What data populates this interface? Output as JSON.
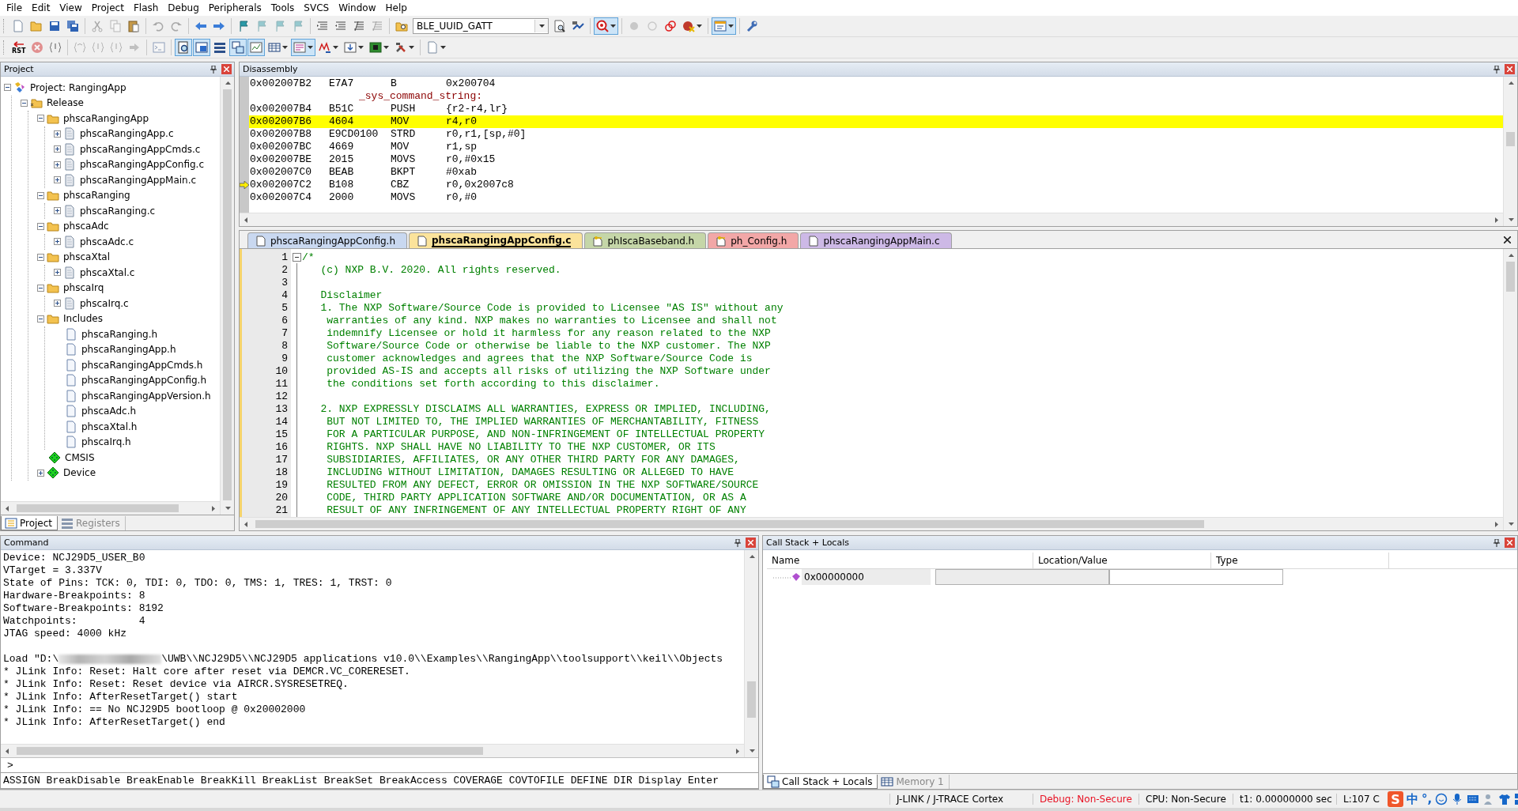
{
  "menu": [
    "File",
    "Edit",
    "View",
    "Project",
    "Flash",
    "Debug",
    "Peripherals",
    "Tools",
    "SVCS",
    "Window",
    "Help"
  ],
  "toolbar_1": [
    {
      "kind": "button",
      "on": false,
      "disabled": false
    },
    {
      "kind": "button",
      "on": false,
      "disabled": false
    },
    {
      "kind": "button",
      "on": false,
      "disabled": false
    },
    {
      "kind": "button",
      "on": false,
      "disabled": false
    },
    {
      "kind": "separator"
    },
    {
      "kind": "button",
      "on": false,
      "disabled": true
    },
    {
      "kind": "button",
      "on": false,
      "disabled": true
    },
    {
      "kind": "button",
      "on": false,
      "disabled": false
    },
    {
      "kind": "separator"
    },
    {
      "kind": "button",
      "on": false,
      "disabled": true
    },
    {
      "kind": "button",
      "on": false,
      "disabled": true
    },
    {
      "kind": "separator"
    },
    {
      "kind": "button",
      "on": false,
      "disabled": false
    },
    {
      "kind": "button",
      "on": false,
      "disabled": false
    },
    {
      "kind": "separator"
    },
    {
      "kind": "button",
      "on": false,
      "disabled": false
    },
    {
      "kind": "button",
      "on": false,
      "disabled": true
    },
    {
      "kind": "button",
      "on": false,
      "disabled": true
    },
    {
      "kind": "button",
      "on": false,
      "disabled": true
    },
    {
      "kind": "separator"
    },
    {
      "kind": "button",
      "on": false,
      "disabled": false
    },
    {
      "kind": "button",
      "on": false,
      "disabled": false
    },
    {
      "kind": "button",
      "on": false,
      "disabled": false
    },
    {
      "kind": "button",
      "on": false,
      "disabled": true
    },
    {
      "kind": "separator"
    },
    {
      "kind": "button",
      "on": false,
      "disabled": false
    },
    {
      "kind": "select",
      "value": "BLE_UUID_GATT"
    },
    {
      "kind": "button",
      "on": false,
      "disabled": false
    },
    {
      "kind": "button",
      "on": false,
      "disabled": false
    },
    {
      "kind": "separator"
    },
    {
      "kind": "menu-button",
      "on": true,
      "disabled": false
    },
    {
      "kind": "separator"
    },
    {
      "kind": "button",
      "on": false,
      "disabled": true
    },
    {
      "kind": "button",
      "on": false,
      "disabled": true
    },
    {
      "kind": "button",
      "on": false,
      "disabled": false
    },
    {
      "kind": "menu-button",
      "on": false,
      "disabled": false
    },
    {
      "kind": "separator"
    },
    {
      "kind": "menu-button",
      "on": true,
      "disabled": false
    },
    {
      "kind": "separator"
    },
    {
      "kind": "button",
      "on": false,
      "disabled": false
    }
  ],
  "toolbar_2": [
    {
      "kind": "reset",
      "label": "RST",
      "on": false,
      "disabled": false
    },
    {
      "kind": "button",
      "on": false,
      "disabled": true
    },
    {
      "kind": "button",
      "on": false,
      "disabled": false
    },
    {
      "kind": "separator"
    },
    {
      "kind": "button",
      "on": false,
      "disabled": true
    },
    {
      "kind": "button",
      "on": false,
      "disabled": true
    },
    {
      "kind": "button",
      "on": false,
      "disabled": true
    },
    {
      "kind": "button",
      "on": false,
      "disabled": true
    },
    {
      "kind": "separator"
    },
    {
      "kind": "button",
      "on": false,
      "disabled": true
    },
    {
      "kind": "separator"
    },
    {
      "kind": "button",
      "on": true,
      "disabled": false
    },
    {
      "kind": "button",
      "on": true,
      "disabled": false
    },
    {
      "kind": "button",
      "on": false,
      "disabled": false
    },
    {
      "kind": "button",
      "on": true,
      "disabled": false
    },
    {
      "kind": "button",
      "on": true,
      "disabled": false
    },
    {
      "kind": "menu-button",
      "on": false,
      "disabled": false
    },
    {
      "kind": "menu-button",
      "on": true,
      "disabled": false
    },
    {
      "kind": "menu-button",
      "on": false,
      "disabled": false
    },
    {
      "kind": "menu-button",
      "on": false,
      "disabled": false
    },
    {
      "kind": "menu-button",
      "on": false,
      "disabled": false
    },
    {
      "kind": "menu-button",
      "on": false,
      "disabled": false
    },
    {
      "kind": "separator"
    },
    {
      "kind": "menu-button",
      "on": false,
      "disabled": false
    }
  ],
  "project_panel": {
    "title": "Project",
    "tree": [
      {
        "label": "Project: RangingApp",
        "kind": "project",
        "expanded": true,
        "children": [
          {
            "label": "Release",
            "kind": "target",
            "expanded": true,
            "children": [
              {
                "label": "phscaRangingApp",
                "kind": "group",
                "expanded": true,
                "children": [
                  {
                    "label": "phscaRangingApp.c",
                    "kind": "source",
                    "expanded": false
                  },
                  {
                    "label": "phscaRangingAppCmds.c",
                    "kind": "source",
                    "expanded": false
                  },
                  {
                    "label": "phscaRangingAppConfig.c",
                    "kind": "source",
                    "expanded": false
                  },
                  {
                    "label": "phscaRangingAppMain.c",
                    "kind": "source",
                    "expanded": false
                  }
                ]
              },
              {
                "label": "phscaRanging",
                "kind": "group",
                "expanded": true,
                "children": [
                  {
                    "label": "phscaRanging.c",
                    "kind": "source",
                    "expanded": false
                  }
                ]
              },
              {
                "label": "phscaAdc",
                "kind": "group",
                "expanded": true,
                "children": [
                  {
                    "label": "phscaAdc.c",
                    "kind": "source",
                    "expanded": false
                  }
                ]
              },
              {
                "label": "phscaXtal",
                "kind": "group",
                "expanded": true,
                "children": [
                  {
                    "label": "phscaXtal.c",
                    "kind": "source",
                    "expanded": false
                  }
                ]
              },
              {
                "label": "phscaIrq",
                "kind": "group",
                "expanded": true,
                "children": [
                  {
                    "label": "phscaIrq.c",
                    "kind": "source",
                    "expanded": false
                  }
                ]
              },
              {
                "label": "Includes",
                "kind": "group",
                "expanded": true,
                "children": [
                  {
                    "label": "phscaRanging.h",
                    "kind": "header"
                  },
                  {
                    "label": "phscaRangingApp.h",
                    "kind": "header"
                  },
                  {
                    "label": "phscaRangingAppCmds.h",
                    "kind": "header"
                  },
                  {
                    "label": "phscaRangingAppConfig.h",
                    "kind": "header"
                  },
                  {
                    "label": "phscaRangingAppVersion.h",
                    "kind": "header"
                  },
                  {
                    "label": "phscaAdc.h",
                    "kind": "header"
                  },
                  {
                    "label": "phscaXtal.h",
                    "kind": "header"
                  },
                  {
                    "label": "phscaIrq.h",
                    "kind": "header"
                  }
                ]
              },
              {
                "label": "CMSIS",
                "kind": "component"
              },
              {
                "label": "Device",
                "kind": "component",
                "expanded": false
              }
            ]
          }
        ]
      }
    ],
    "tabs": [
      {
        "label": "Project",
        "selected": true
      },
      {
        "label": "Registers",
        "selected": false
      }
    ]
  },
  "disassembly": {
    "title": "Disassembly",
    "rows": [
      {
        "kind": "instruction",
        "address": "0x002007B2",
        "code": "E7A7",
        "mnemonic": "B",
        "operands": "0x200704",
        "current": false,
        "pointer": false
      },
      {
        "kind": "label",
        "text": "_sys_command_string:"
      },
      {
        "kind": "instruction",
        "address": "0x002007B4",
        "code": "B51C",
        "mnemonic": "PUSH",
        "operands": "{r2-r4,lr}",
        "current": false,
        "pointer": false
      },
      {
        "kind": "instruction",
        "address": "0x002007B6",
        "code": "4604",
        "mnemonic": "MOV",
        "operands": "r4,r0",
        "current": true,
        "pointer": false
      },
      {
        "kind": "instruction",
        "address": "0x002007B8",
        "code": "E9CD0100",
        "mnemonic": "STRD",
        "operands": "r0,r1,[sp,#0]",
        "current": false,
        "pointer": false
      },
      {
        "kind": "instruction",
        "address": "0x002007BC",
        "code": "4669",
        "mnemonic": "MOV",
        "operands": "r1,sp",
        "current": false,
        "pointer": false
      },
      {
        "kind": "instruction",
        "address": "0x002007BE",
        "code": "2015",
        "mnemonic": "MOVS",
        "operands": "r0,#0x15",
        "current": false,
        "pointer": false
      },
      {
        "kind": "instruction",
        "address": "0x002007C0",
        "code": "BEAB",
        "mnemonic": "BKPT",
        "operands": "#0xab",
        "current": false,
        "pointer": false
      },
      {
        "kind": "instruction",
        "address": "0x002007C2",
        "code": "B108",
        "mnemonic": "CBZ",
        "operands": "r0,0x2007c8",
        "current": false,
        "pointer": true
      },
      {
        "kind": "instruction",
        "address": "0x002007C4",
        "code": "2000",
        "mnemonic": "MOVS",
        "operands": "r0,#0",
        "current": false,
        "pointer": false
      }
    ]
  },
  "editor": {
    "tabs": [
      {
        "label": "phscaRangingAppConfig.h",
        "kind": "file",
        "selected": false,
        "color": "#c9d8f0"
      },
      {
        "label": "phscaRangingAppConfig.c",
        "kind": "file",
        "selected": true,
        "color": "#fbe39b"
      },
      {
        "label": "phIscaBaseband.h",
        "kind": "locked",
        "selected": false,
        "color": "#c5d6a8"
      },
      {
        "label": "ph_Config.h",
        "kind": "locked",
        "selected": false,
        "color": "#f2a7a7"
      },
      {
        "label": "phscaRangingAppMain.c",
        "kind": "file",
        "selected": false,
        "color": "#cdb9e6"
      }
    ],
    "lines": [
      {
        "number": "1",
        "text": "/*",
        "fold": true
      },
      {
        "number": "2",
        "text": "   (c) NXP B.V. 2020. All rights reserved.",
        "fold": false
      },
      {
        "number": "3",
        "fold": false
      },
      {
        "number": "4",
        "text": "   Disclaimer",
        "fold": false
      },
      {
        "number": "5",
        "text": "   1. The NXP Software/Source Code is provided to Licensee \"AS IS\" without any",
        "fold": false
      },
      {
        "number": "6",
        "text": "    warranties of any kind. NXP makes no warranties to Licensee and shall not",
        "fold": false
      },
      {
        "number": "7",
        "text": "    indemnify Licensee or hold it harmless for any reason related to the NXP",
        "fold": false
      },
      {
        "number": "8",
        "text": "    Software/Source Code or otherwise be liable to the NXP customer. The NXP",
        "fold": false
      },
      {
        "number": "9",
        "text": "    customer acknowledges and agrees that the NXP Software/Source Code is",
        "fold": false
      },
      {
        "number": "10",
        "text": "    provided AS-IS and accepts all risks of utilizing the NXP Software under",
        "fold": false
      },
      {
        "number": "11",
        "text": "    the conditions set forth according to this disclaimer.",
        "fold": false
      },
      {
        "number": "12",
        "fold": false
      },
      {
        "number": "13",
        "text": "   2. NXP EXPRESSLY DISCLAIMS ALL WARRANTIES, EXPRESS OR IMPLIED, INCLUDING,",
        "fold": false
      },
      {
        "number": "14",
        "text": "    BUT NOT LIMITED TO, THE IMPLIED WARRANTIES OF MERCHANTABILITY, FITNESS",
        "fold": false
      },
      {
        "number": "15",
        "text": "    FOR A PARTICULAR PURPOSE, AND NON-INFRINGEMENT OF INTELLECTUAL PROPERTY",
        "fold": false
      },
      {
        "number": "16",
        "text": "    RIGHTS. NXP SHALL HAVE NO LIABILITY TO THE NXP CUSTOMER, OR ITS",
        "fold": false
      },
      {
        "number": "17",
        "text": "    SUBSIDIARIES, AFFILIATES, OR ANY OTHER THIRD PARTY FOR ANY DAMAGES,",
        "fold": false
      },
      {
        "number": "18",
        "text": "    INCLUDING WITHOUT LIMITATION, DAMAGES RESULTING OR ALLEGED TO HAVE",
        "fold": false
      },
      {
        "number": "19",
        "text": "    RESULTED FROM ANY DEFECT, ERROR OR OMISSION IN THE NXP SOFTWARE/SOURCE",
        "fold": false
      },
      {
        "number": "20",
        "text": "    CODE, THIRD PARTY APPLICATION SOFTWARE AND/OR DOCUMENTATION, OR AS A",
        "fold": false
      },
      {
        "number": "21",
        "text": "    RESULT OF ANY INFRINGEMENT OF ANY INTELLECTUAL PROPERTY RIGHT OF ANY",
        "fold": false
      }
    ]
  },
  "command": {
    "title": "Command",
    "output": [
      {
        "kind": "text",
        "text": "Device: NCJ29D5_USER_B0"
      },
      {
        "kind": "text",
        "text": "VTarget = 3.337V"
      },
      {
        "kind": "text",
        "text": "State of Pins: TCK: 0, TDI: 0, TDO: 0, TMS: 1, TRES: 1, TRST: 0"
      },
      {
        "kind": "text",
        "text": "Hardware-Breakpoints: 8"
      },
      {
        "kind": "text",
        "text": "Software-Breakpoints: 8192"
      },
      {
        "kind": "text",
        "text": "Watchpoints:          4"
      },
      {
        "kind": "text",
        "text": "JTAG speed: 4000 kHz"
      },
      {
        "kind": "blank"
      },
      {
        "kind": "redacted",
        "before": "Load \"D:\\",
        "after": "\\UWB\\\\NCJ29D5\\\\NCJ29D5 applications v10.0\\\\Examples\\\\RangingApp\\\\toolsupport\\\\keil\\\\Objects"
      },
      {
        "kind": "text",
        "text": "* JLink Info: Reset: Halt core after reset via DEMCR.VC_CORERESET."
      },
      {
        "kind": "text",
        "text": "* JLink Info: Reset: Reset device via AIRCR.SYSRESETREQ."
      },
      {
        "kind": "text",
        "text": "* JLink Info: AfterResetTarget() start"
      },
      {
        "kind": "text",
        "text": "* JLink Info: == No NCJ29D5 bootloop @ 0x20002000"
      },
      {
        "kind": "text",
        "text": "* JLink Info: AfterResetTarget() end"
      }
    ],
    "prompt": ">",
    "commands": "ASSIGN BreakDisable BreakEnable BreakKill BreakList BreakSet BreakAccess COVERAGE COVTOFILE DEFINE DIR Display Enter"
  },
  "call_stack": {
    "title": "Call Stack + Locals",
    "columns": [
      "Name",
      "Location/Value",
      "Type"
    ],
    "rows": [
      {
        "name": "0x00000000"
      }
    ],
    "tabs": [
      {
        "label": "Call Stack + Locals",
        "selected": true
      },
      {
        "label": "Memory 1",
        "selected": false
      }
    ]
  },
  "status_bar": [
    {
      "text": "J-LINK / J-TRACE Cortex",
      "color": "#000000"
    },
    {
      "text": "Debug: Non-Secure",
      "color": "#e81123"
    },
    {
      "text": "CPU: Non-Secure",
      "color": "#000000"
    },
    {
      "text": "t1: 0.00000000 sec",
      "color": "#000000"
    },
    {
      "text": "L:107 C",
      "color": "#000000"
    }
  ],
  "ime_bar": {
    "logo": "S",
    "language": "中",
    "punctuation": "°,"
  }
}
